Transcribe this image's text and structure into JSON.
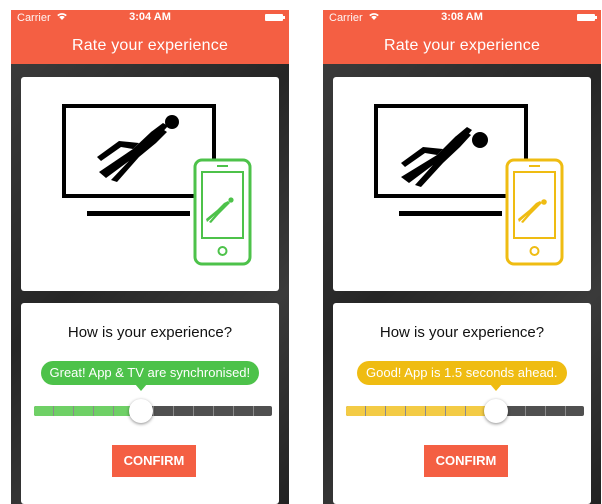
{
  "screens": [
    {
      "status": {
        "carrier": "Carrier",
        "time": "3:04 AM"
      },
      "header": {
        "title": "Rate your experience"
      },
      "question": "How is your experience?",
      "feedback": {
        "label": "Great! App & TV are synchronised!",
        "color": "#4dc24a"
      },
      "slider": {
        "position_percent": 45,
        "fill_color": "#6fd066"
      },
      "phone_device_color": "#4dc24a",
      "confirm_label": "CONFIRM"
    },
    {
      "status": {
        "carrier": "Carrier",
        "time": "3:08 AM"
      },
      "header": {
        "title": "Rate your experience"
      },
      "question": "How is your experience?",
      "feedback": {
        "label": "Good! App is 1.5 seconds ahead.",
        "color": "#efbc12"
      },
      "slider": {
        "position_percent": 63,
        "fill_color": "#f3cb45"
      },
      "phone_device_color": "#efbc12",
      "confirm_label": "CONFIRM"
    }
  ],
  "theme": {
    "accent": "#f45f43"
  },
  "icons": {
    "wifi": "wifi-icon",
    "battery": "battery-icon",
    "illustration": "goalkeeper-diving-illustration"
  }
}
